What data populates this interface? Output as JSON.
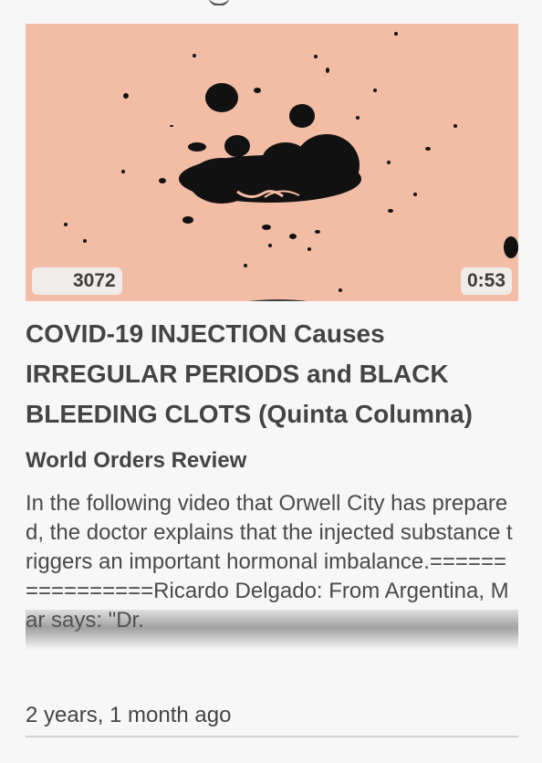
{
  "video": {
    "views": "3072",
    "duration": "0:53",
    "title": "COVID-19 INJECTION Causes IRREGULAR PERIODS and BLACK BLEEDING CLOTS (Quinta Columna)",
    "source": "World Orders Review",
    "description": "In the following video that Orwell City has prepared, the doctor explains that the injected substance triggers an important hormonal imbalance.================Ricardo Delgado: From Argentina, Mar says: \"Dr.",
    "posted": "2 years, 1 month ago"
  },
  "icons": {
    "views_icon": "eye-icon"
  },
  "colors": {
    "thumbnail_bg": "#f3bca4",
    "text": "#444444",
    "page_bg": "#f7f7f7"
  }
}
